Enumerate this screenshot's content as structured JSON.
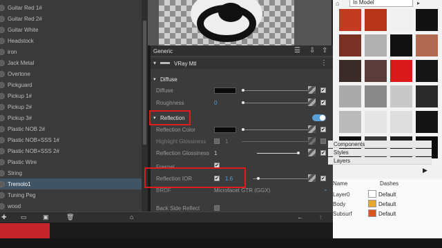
{
  "materials": [
    {
      "label": "Guitar Red 1#",
      "selected": false
    },
    {
      "label": "Guitar Red 2#",
      "selected": false
    },
    {
      "label": "Guitar White",
      "selected": false
    },
    {
      "label": "Headstock",
      "selected": false
    },
    {
      "label": "iron",
      "selected": false
    },
    {
      "label": "Jack Metal",
      "selected": false
    },
    {
      "label": "Overtone",
      "selected": false
    },
    {
      "label": "Pickguard",
      "selected": false
    },
    {
      "label": "Pickup 1#",
      "selected": false
    },
    {
      "label": "Pickup 2#",
      "selected": false
    },
    {
      "label": "Pickup 3#",
      "selected": false
    },
    {
      "label": "Plastic NOB 2#",
      "selected": false
    },
    {
      "label": "Plastic NOB+SSS 1#",
      "selected": false
    },
    {
      "label": "Plastic NOB+SSS 2#",
      "selected": false
    },
    {
      "label": "Plastic Wire",
      "selected": false
    },
    {
      "label": "String",
      "selected": false
    },
    {
      "label": "Tremolo1",
      "selected": true
    },
    {
      "label": "Tuning Peg",
      "selected": false
    },
    {
      "label": "wood",
      "selected": false
    }
  ],
  "editor": {
    "generic_label": "Generic",
    "material_type": "VRay Mtl",
    "diffuse": {
      "header": "Diffuse",
      "diffuse_label": "Diffuse",
      "roughness_label": "Roughness",
      "roughness_value": "0"
    },
    "reflection": {
      "header": "Reflection",
      "color_label": "Reflection Color",
      "highlight_label": "Highlight Glossiness",
      "highlight_value": "1",
      "refl_gloss_label": "Reflection Glossiness",
      "refl_gloss_value": "1",
      "fresnel_label": "Fresnel",
      "ior_label": "Reflection IOR",
      "ior_value": "1.6",
      "brdf_label": "BRDF",
      "brdf_value": "Microfacet GTR (GGX)",
      "backside_label": "Back Side Reflect"
    }
  },
  "right": {
    "model_dropdown": "In Model",
    "dock_components": "Components",
    "dock_styles": "Styles",
    "dock_layers": "Layers",
    "col_name": "Name",
    "col_dashes": "Dashes",
    "layers": [
      {
        "name": "Layer0",
        "dashes": "Default",
        "color": "#ffffff"
      },
      {
        "name": "Body",
        "dashes": "Default",
        "color": "#e8a62a"
      },
      {
        "name": "Subsurf",
        "dashes": "Default",
        "color": "#d8561e"
      }
    ]
  },
  "colors": {
    "accent": "#5aa0d8",
    "highlight_box": "#e01b1b",
    "selection": "#3f5566"
  }
}
